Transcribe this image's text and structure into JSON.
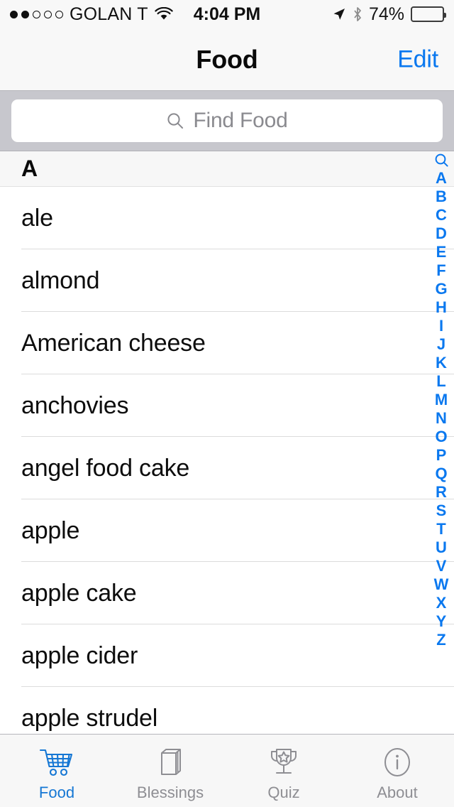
{
  "status_bar": {
    "carrier": "GOLAN T",
    "signal_dots_total": 5,
    "signal_dots_filled": 2,
    "wifi_icon": "wifi-icon",
    "time": "4:04 PM",
    "location_icon": "location-arrow-icon",
    "bluetooth_icon": "bluetooth-icon",
    "battery_percent": "74%",
    "battery_level": 74
  },
  "nav_bar": {
    "title": "Food",
    "edit_label": "Edit"
  },
  "search": {
    "placeholder": "Find Food",
    "value": "",
    "icon": "search-icon"
  },
  "list": {
    "section_header": "A",
    "items": [
      {
        "label": "ale"
      },
      {
        "label": "almond"
      },
      {
        "label": "American cheese"
      },
      {
        "label": "anchovies"
      },
      {
        "label": "angel food cake"
      },
      {
        "label": "apple"
      },
      {
        "label": "apple cake"
      },
      {
        "label": "apple cider"
      },
      {
        "label": "apple strudel"
      }
    ]
  },
  "index_bar": {
    "search_icon": "search-icon",
    "letters": [
      "A",
      "B",
      "C",
      "D",
      "E",
      "F",
      "G",
      "H",
      "I",
      "J",
      "K",
      "L",
      "M",
      "N",
      "O",
      "P",
      "Q",
      "R",
      "S",
      "T",
      "U",
      "V",
      "W",
      "X",
      "Y",
      "Z"
    ]
  },
  "tab_bar": {
    "items": [
      {
        "label": "Food",
        "icon": "shopping-cart-icon",
        "active": true
      },
      {
        "label": "Blessings",
        "icon": "book-icon",
        "active": false
      },
      {
        "label": "Quiz",
        "icon": "trophy-icon",
        "active": false
      },
      {
        "label": "About",
        "icon": "info-circle-icon",
        "active": false
      }
    ]
  },
  "colors": {
    "accent_blue": "#0a78ef",
    "tab_active": "#1577d4",
    "tab_inactive": "#8e8e93",
    "search_bar_bg": "#c7c7cd"
  }
}
